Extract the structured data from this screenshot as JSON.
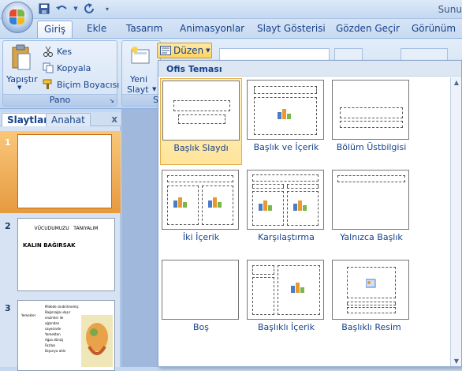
{
  "window": {
    "title_fragment": "Sunu"
  },
  "quick_access": {
    "items": [
      "save-icon",
      "undo-icon",
      "redo-icon",
      "customize-icon"
    ]
  },
  "tabs": [
    "Giriş",
    "Ekle",
    "Tasarım",
    "Animasyonlar",
    "Slayt Gösterisi",
    "Gözden Geçir",
    "Görünüm"
  ],
  "ribbon": {
    "paste_label": "Yapıştır",
    "cut_label": "Kes",
    "copy_label": "Kopyala",
    "format_painter_label": "Biçim Boyacısı",
    "clipboard_group": "Pano",
    "new_slide_line1": "Yeni",
    "new_slide_line2": "Slayt",
    "slides_group_fragment": "S",
    "layout_button": "Düzen"
  },
  "pane": {
    "tab_slides": "Slaytlar",
    "tab_outline": "Anahat",
    "close": "x",
    "slides": [
      {
        "number": "1"
      },
      {
        "number": "2",
        "title": "VÜCUDUMUZU   TANIYALIM",
        "subtitle": "KALIN BAĞIRSAK"
      },
      {
        "number": "3",
        "side_label": "Yemekler",
        "lines": [
          "Midede sindirilmemiş",
          "Bağırsağa ulaşır",
          "enzimler ile",
          "ağzından",
          "sayesinde",
          "Yemekten",
          "Ağza dönüş",
          "Fazlası",
          "Dışarıya atılır"
        ]
      }
    ]
  },
  "gallery": {
    "header": "Ofis Teması",
    "layouts": [
      "Başlık Slaydı",
      "Başlık ve İçerik",
      "Bölüm Üstbilgisi",
      "İki İçerik",
      "Karşılaştırma",
      "Yalnızca Başlık",
      "Boş",
      "Başlıklı İçerik",
      "Başlıklı Resim"
    ],
    "selected_index": 0
  },
  "colors": {
    "accent": "#15428b",
    "selected": "#ffd35d",
    "ribbon": "#d2e1f4"
  }
}
